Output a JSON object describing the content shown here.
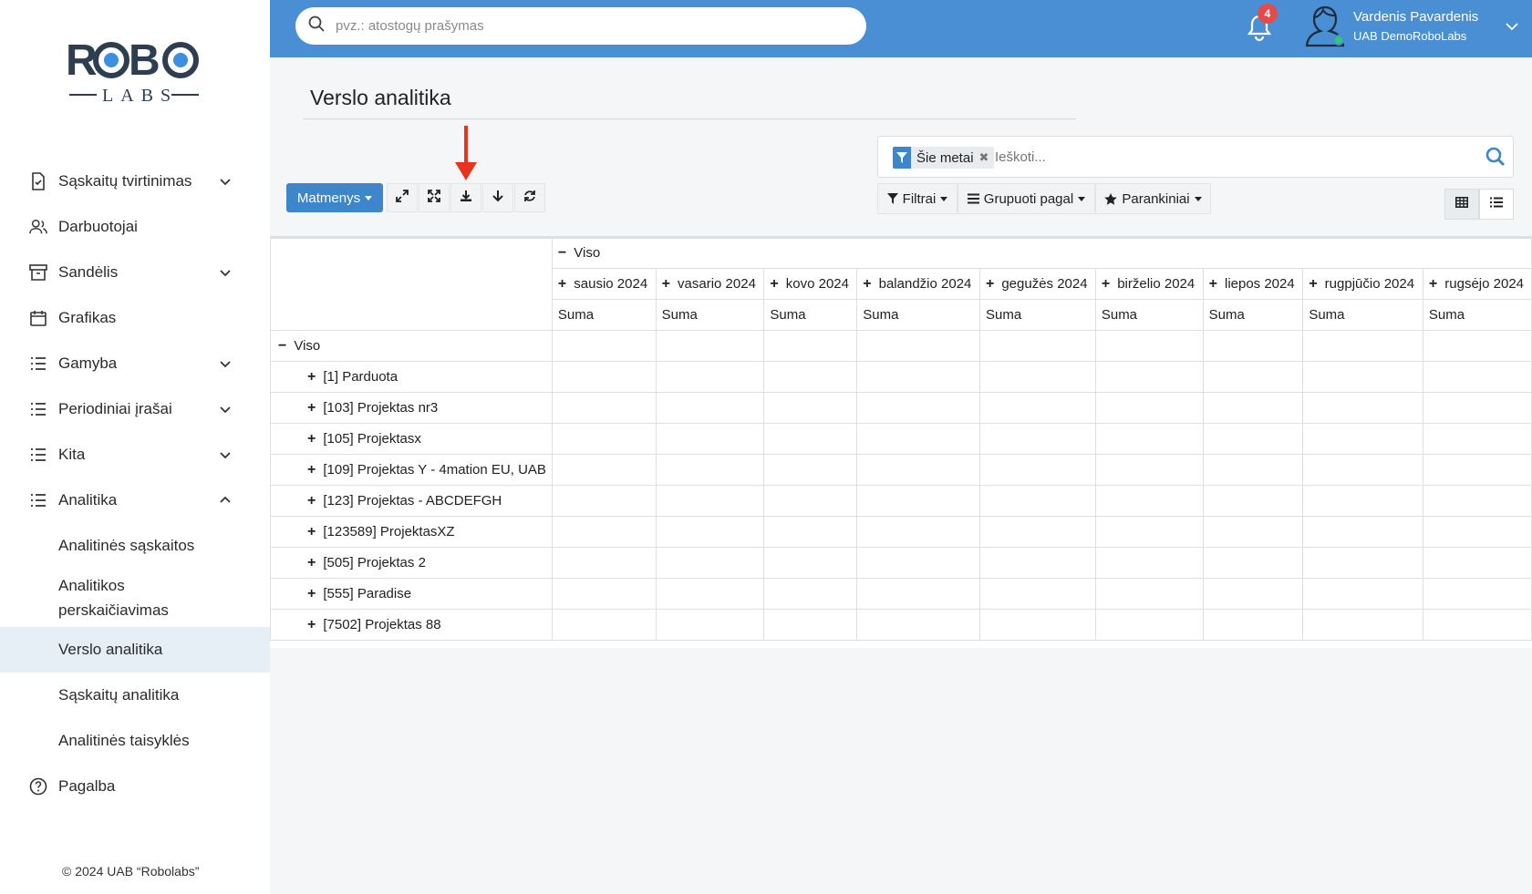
{
  "logo": {
    "top": "ROBO",
    "bottom": "LABS"
  },
  "sidebar": {
    "items": [
      {
        "label": "Sąskaitų tvirtinimas",
        "icon": "document-check-icon",
        "expandable": true
      },
      {
        "label": "Darbuotojai",
        "icon": "users-icon",
        "expandable": false
      },
      {
        "label": "Sandėlis",
        "icon": "archive-icon",
        "expandable": true
      },
      {
        "label": "Grafikas",
        "icon": "calendar-icon",
        "expandable": false
      },
      {
        "label": "Gamyba",
        "icon": "list-icon",
        "expandable": true
      },
      {
        "label": "Periodiniai įrašai",
        "icon": "list-icon",
        "expandable": true
      },
      {
        "label": "Kita",
        "icon": "list-icon",
        "expandable": true
      },
      {
        "label": "Analitika",
        "icon": "list-icon",
        "expandable": true,
        "expanded": true
      }
    ],
    "subitems": [
      {
        "label": "Analitinės sąskaitos"
      },
      {
        "label": "Analitikos perskaičiavimas"
      },
      {
        "label": "Verslo analitika",
        "active": true
      },
      {
        "label": "Sąskaitų analitika"
      },
      {
        "label": "Analitinės taisyklės"
      }
    ],
    "help": {
      "label": "Pagalba",
      "icon": "help-circle-icon"
    },
    "copyright": "© 2024 UAB “Robolabs”"
  },
  "topbar": {
    "search_placeholder": "pvz.: atostogų prašymas",
    "notifications_count": "4",
    "user_name": "Vardenis Pavardenis",
    "user_company": "UAB DemoRoboLabs",
    "status_color": "#2ecc71",
    "accent": "#4a8fd4"
  },
  "page": {
    "title": "Verslo analitika"
  },
  "toolbar": {
    "measures_label": "Matmenys",
    "buttons": [
      "expand-icon",
      "fullscreen-icon",
      "download-icon",
      "arrow-down-icon",
      "refresh-icon"
    ]
  },
  "facets": {
    "active_filter": "Šie metai",
    "search_placeholder": "Ieškoti...",
    "filters_label": "Filtrai",
    "group_by_label": "Grupuoti pagal",
    "favorites_label": "Parankiniai"
  },
  "pivot": {
    "total_label": "Viso",
    "months": [
      "sausio 2024",
      "vasario 2024",
      "kovo 2024",
      "balandžio 2024",
      "gegužės 2024",
      "birželio 2024",
      "liepos 2024",
      "rugpjūčio 2024",
      "rugsėjo 2024"
    ],
    "measure": "Suma",
    "row_total": "Viso",
    "rows": [
      "[1] Parduota",
      "[103] Projektas nr3",
      "[105] Projektasx",
      "[109] Projektas Y - 4mation EU, UAB",
      "[123] Projektas - ABCDEFGH",
      "[123589] ProjektasXZ",
      "[505] Projektas 2",
      "[555] Paradise",
      "[7502] Projektas 88"
    ]
  }
}
